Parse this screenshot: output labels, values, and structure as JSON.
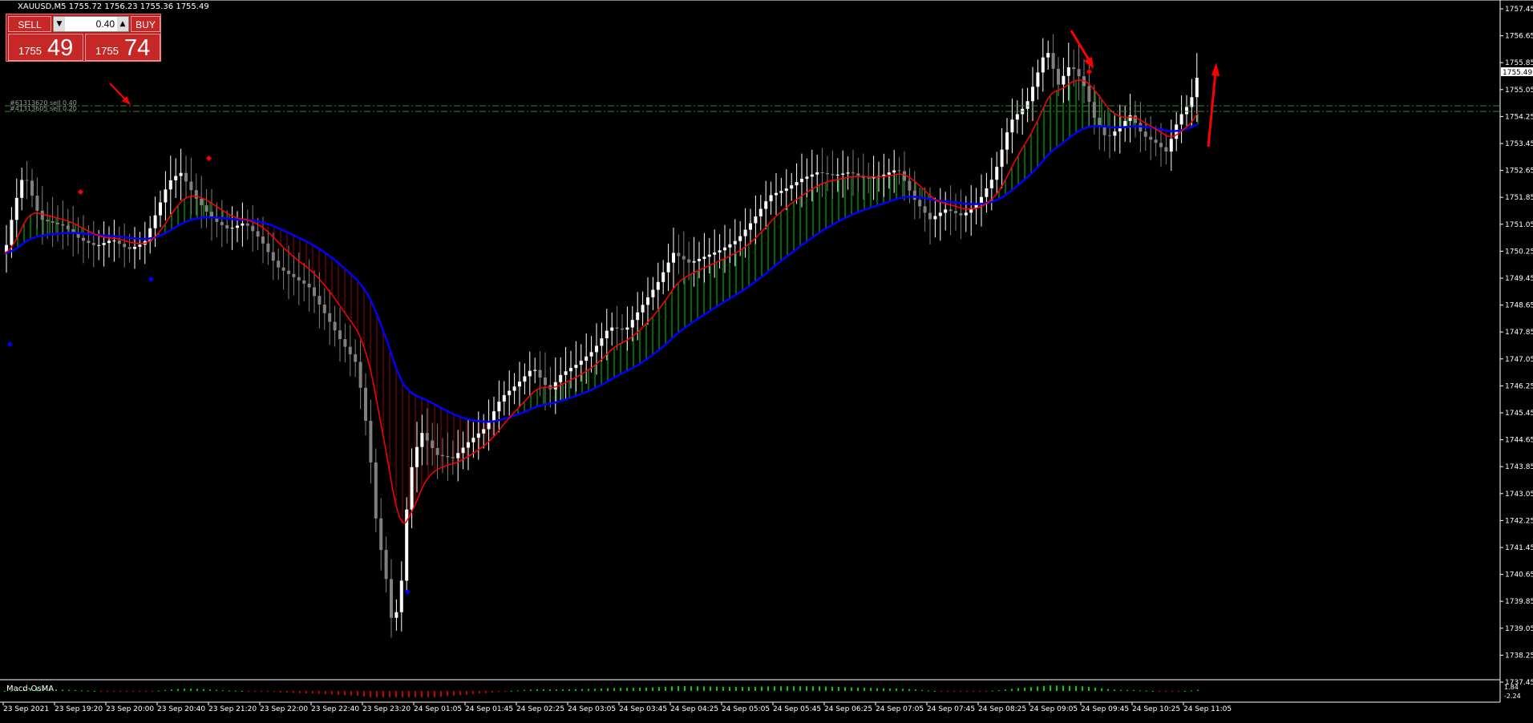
{
  "window": {
    "symbol": "XAUUSD,M5",
    "ohlc": "1755.72 1756.23 1755.36 1755.49"
  },
  "trade_panel": {
    "sell_label": "SELL",
    "buy_label": "BUY",
    "lot_value": "0.40",
    "sell_price_small": "1755",
    "sell_price_big": "49",
    "buy_price_small": "1755",
    "buy_price_big": "74"
  },
  "orders": {
    "line1_label": "#61313620 sell 0.40",
    "line2_label": "#41313605 sell 0.20"
  },
  "price_axis": {
    "labels": [
      "1757.45",
      "1756.65",
      "1755.85",
      "1755.05",
      "1754.25",
      "1753.45",
      "1752.65",
      "1751.85",
      "1751.05",
      "1750.25",
      "1749.45",
      "1748.65",
      "1747.85",
      "1747.05",
      "1746.25",
      "1745.45",
      "1744.65",
      "1743.85",
      "1743.05",
      "1742.25",
      "1741.45",
      "1740.65",
      "1739.85",
      "1739.05",
      "1738.25",
      "1737.45"
    ],
    "current_price": "1755.49"
  },
  "time_axis": {
    "labels": [
      "23 Sep 2021",
      "23 Sep 19:20",
      "23 Sep 20:00",
      "23 Sep 20:40",
      "23 Sep 21:20",
      "23 Sep 22:00",
      "23 Sep 22:40",
      "23 Sep 23:20",
      "24 Sep 01:05",
      "24 Sep 01:45",
      "24 Sep 02:25",
      "24 Sep 03:05",
      "24 Sep 03:45",
      "24 Sep 04:25",
      "24 Sep 05:05",
      "24 Sep 05:45",
      "24 Sep 06:25",
      "24 Sep 07:05",
      "24 Sep 07:45",
      "24 Sep 08:25",
      "24 Sep 09:05",
      "24 Sep 09:45",
      "24 Sep 10:25",
      "24 Sep 11:05"
    ]
  },
  "indicator": {
    "name": "Macd-OsMA",
    "axis_top": "1.84",
    "axis_bottom": "-2.24"
  },
  "colors": {
    "background": "#000000",
    "bull_candle": "#ffffff",
    "bear_candle": "#808080",
    "upper_line": "#ff0000",
    "lower_line": "#0000ff",
    "bull_fill": "#00cc00",
    "bear_fill": "#990000",
    "order_line": "#2e8b2e",
    "arrow": "#ff0000"
  }
}
